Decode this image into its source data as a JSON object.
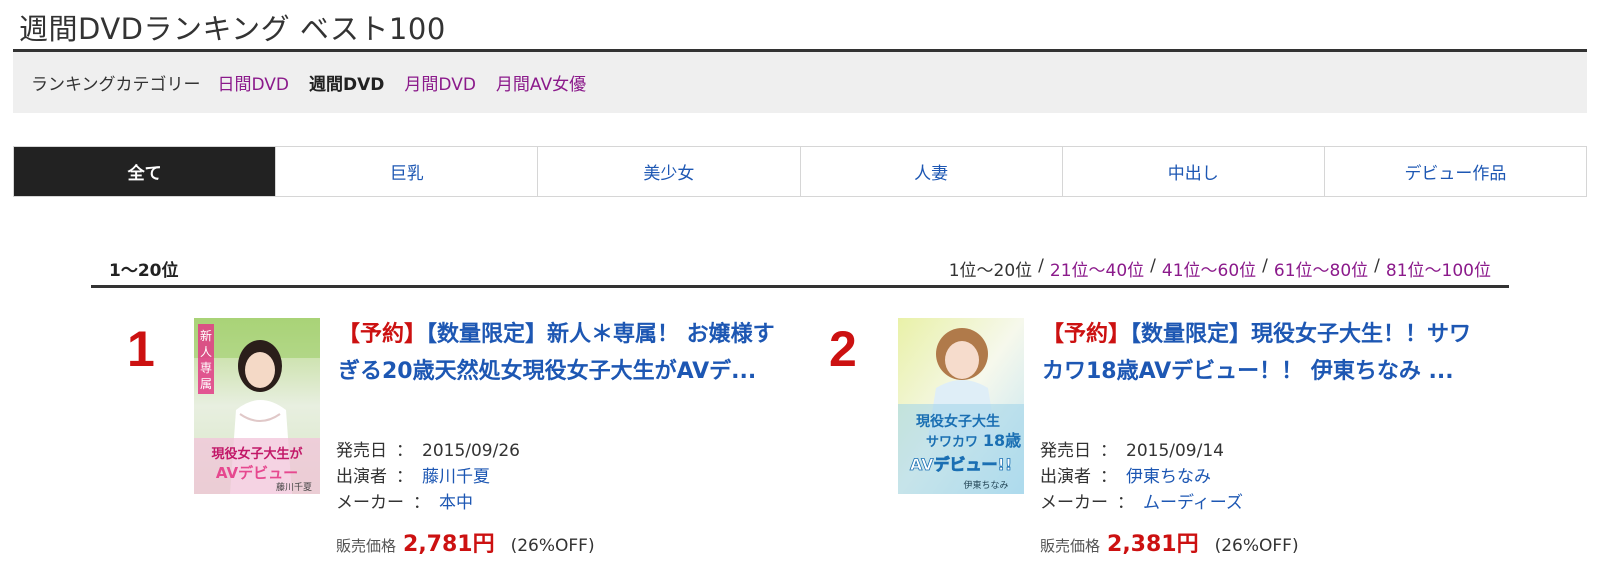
{
  "page": {
    "title": "週間DVDランキング ベスト100"
  },
  "category_bar": {
    "label": "ランキングカテゴリー",
    "links": [
      {
        "label": "日間DVD",
        "current": false
      },
      {
        "label": "週間DVD",
        "current": true
      },
      {
        "label": "月間DVD",
        "current": false
      },
      {
        "label": "月間AV女優",
        "current": false
      }
    ]
  },
  "tabs": [
    {
      "label": "全て",
      "active": true
    },
    {
      "label": "巨乳",
      "active": false
    },
    {
      "label": "美少女",
      "active": false
    },
    {
      "label": "人妻",
      "active": false
    },
    {
      "label": "中出し",
      "active": false
    },
    {
      "label": "デビュー作品",
      "active": false
    }
  ],
  "range": {
    "current": "1〜20位",
    "pager": [
      {
        "label": "1位〜20位",
        "current": true
      },
      {
        "label": "21位〜40位",
        "current": false
      },
      {
        "label": "41位〜60位",
        "current": false
      },
      {
        "label": "61位〜80位",
        "current": false
      },
      {
        "label": "81位〜100位",
        "current": false
      }
    ],
    "separator": "/"
  },
  "items": [
    {
      "rank": "1",
      "tag": "【予約】",
      "title": "【数量限定】新人＊専属！ お嬢様すぎる20歳天然処女現役女子大生がAVデ...",
      "release_label": "発売日",
      "release_date": "2015/09/26",
      "performer_label": "出演者",
      "performer": "藤川千夏",
      "maker_label": "メーカー",
      "maker": "本中",
      "price_label": "販売価格",
      "price": "2,781円",
      "discount": "(26%OFF)",
      "cover_text": "新人＊専属！ 現役女子大生が AVデビュー 藤川千夏"
    },
    {
      "rank": "2",
      "tag": "【予約】",
      "title": "【数量限定】現役女子大生！！サワカワ18歳AVデビュー！！ 伊東ちなみ ...",
      "release_label": "発売日",
      "release_date": "2015/09/14",
      "performer_label": "出演者",
      "performer": "伊東ちなみ",
      "maker_label": "メーカー",
      "maker": "ムーディーズ",
      "price_label": "販売価格",
      "price": "2,381円",
      "discount": "(26%OFF)",
      "cover_text": "現役女子大生 サワカワ18歳 AVデビュー!! 伊東ちなみ"
    }
  ]
}
